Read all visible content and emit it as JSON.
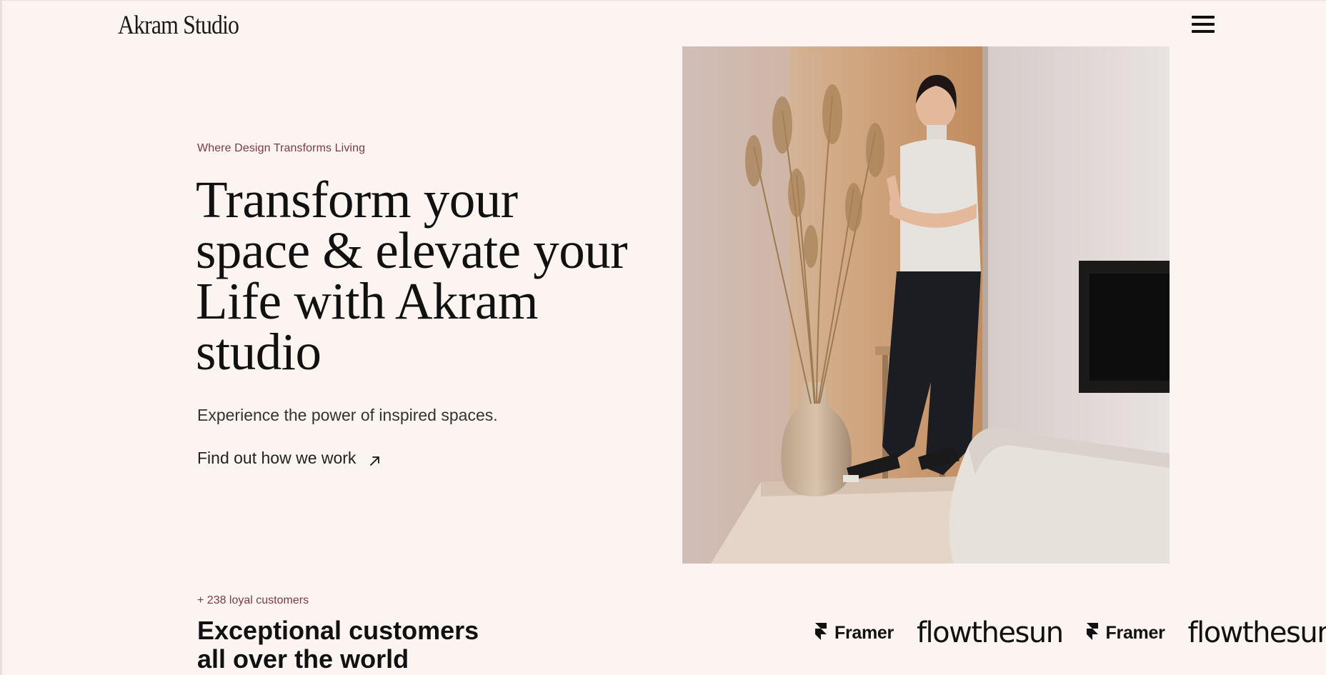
{
  "header": {
    "logo_text": "Akram Studio",
    "menu_icon": "hamburger-menu-icon"
  },
  "hero": {
    "eyebrow": "Where Design Transforms Living",
    "title_lines": [
      "Transform your",
      "space & elevate your",
      "Life with Akram",
      "studio"
    ],
    "subtitle": "Experience the power of inspired spaces.",
    "cta_label": "Find out how we work",
    "cta_icon": "arrow-up-right-icon",
    "image_alt": "Woman in sleeveless top leaning against a wall beside dried pampas grass in a glass vase"
  },
  "customers": {
    "count_label": "+ 238 loyal customers",
    "title_lines": [
      "Exceptional customers",
      "all over the world"
    ],
    "logos": [
      "Framer",
      "flowthesun",
      "Framer",
      "flowthesun"
    ]
  },
  "colors": {
    "background": "#fcf4f0",
    "accent": "#7b3b40",
    "text": "#111111"
  }
}
